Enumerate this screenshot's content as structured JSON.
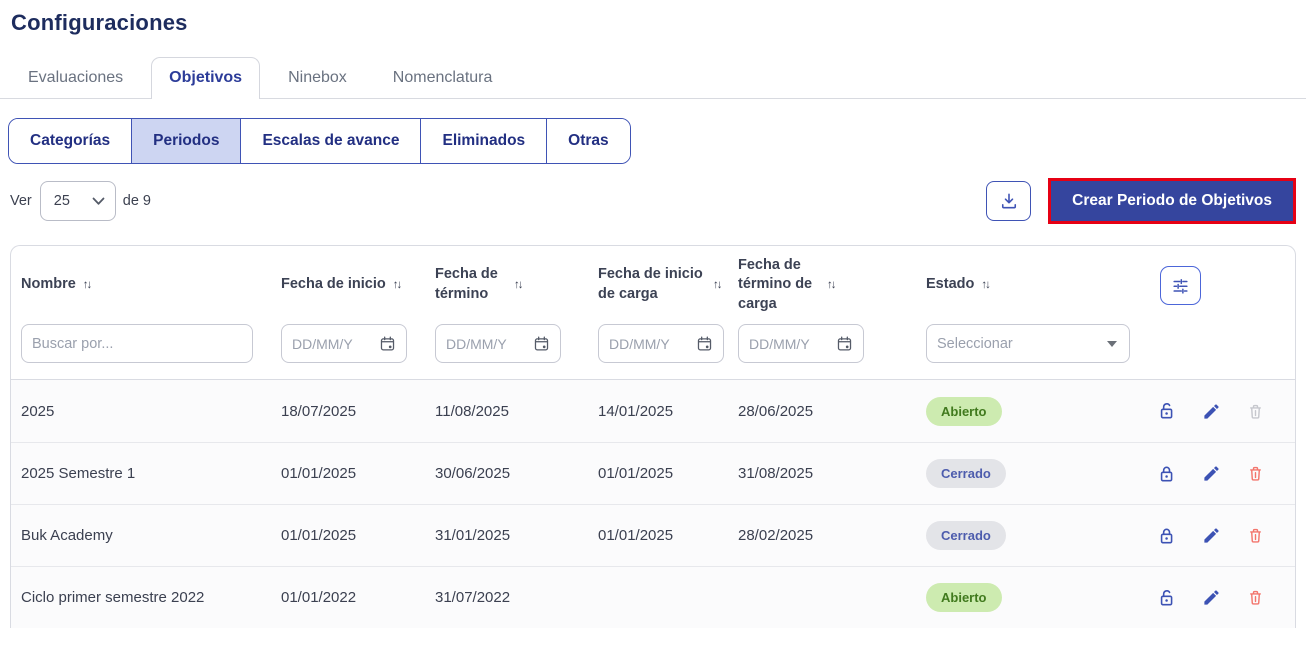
{
  "page": {
    "title": "Configuraciones"
  },
  "tabs": {
    "items": [
      {
        "label": "Evaluaciones",
        "active": "false"
      },
      {
        "label": "Objetivos",
        "active": "true"
      },
      {
        "label": "Ninebox",
        "active": "false"
      },
      {
        "label": "Nomenclatura",
        "active": "false"
      }
    ]
  },
  "subtabs": {
    "items": [
      {
        "label": "Categorías",
        "active": "false"
      },
      {
        "label": "Periodos",
        "active": "true"
      },
      {
        "label": "Escalas de avance",
        "active": "false"
      },
      {
        "label": "Eliminados",
        "active": "false"
      },
      {
        "label": "Otras",
        "active": "false"
      }
    ]
  },
  "toolbar": {
    "ver_label": "Ver",
    "page_size": "25",
    "total_text": "de 9",
    "download_icon": "download-icon",
    "create_button_label": "Crear Periodo de Objetivos"
  },
  "table": {
    "sort_icon": "↑↓",
    "columns": {
      "nombre": "Nombre",
      "fecha_inicio": "Fecha de inicio",
      "fecha_termino": "Fecha de término",
      "fecha_inicio_carga": "Fecha de inicio de carga",
      "fecha_termino_carga": "Fecha de término de carga",
      "estado": "Estado"
    },
    "filters": {
      "search_placeholder": "Buscar por...",
      "date_placeholder": "DD/MM/Y",
      "estado_placeholder": "Seleccionar"
    },
    "rows": [
      {
        "nombre": "2025",
        "fecha_inicio": "18/07/2025",
        "fecha_termino": "11/08/2025",
        "fecha_inicio_carga": "14/01/2025",
        "fecha_termino_carga": "28/06/2025",
        "estado": "Abierto",
        "estado_variant": "abierto",
        "lock": "open",
        "delete_enabled": "false"
      },
      {
        "nombre": "2025 Semestre 1",
        "fecha_inicio": "01/01/2025",
        "fecha_termino": "30/06/2025",
        "fecha_inicio_carga": "01/01/2025",
        "fecha_termino_carga": "31/08/2025",
        "estado": "Cerrado",
        "estado_variant": "cerrado",
        "lock": "closed",
        "delete_enabled": "true"
      },
      {
        "nombre": "Buk Academy",
        "fecha_inicio": "01/01/2025",
        "fecha_termino": "31/01/2025",
        "fecha_inicio_carga": "01/01/2025",
        "fecha_termino_carga": "28/02/2025",
        "estado": "Cerrado",
        "estado_variant": "cerrado",
        "lock": "closed",
        "delete_enabled": "true"
      },
      {
        "nombre": "Ciclo primer semestre 2022",
        "fecha_inicio": "01/01/2022",
        "fecha_termino": "31/07/2022",
        "fecha_inicio_carga": "",
        "fecha_termino_carga": "",
        "estado": "Abierto",
        "estado_variant": "abierto",
        "lock": "open",
        "delete_enabled": "true"
      }
    ]
  },
  "colors": {
    "accent": "#35459e",
    "highlight_red": "#e60014",
    "badge_open_bg": "#cdebb0",
    "badge_open_text": "#417a1e",
    "badge_closed_bg": "#e3e4e8",
    "badge_closed_text": "#4d5cad"
  }
}
